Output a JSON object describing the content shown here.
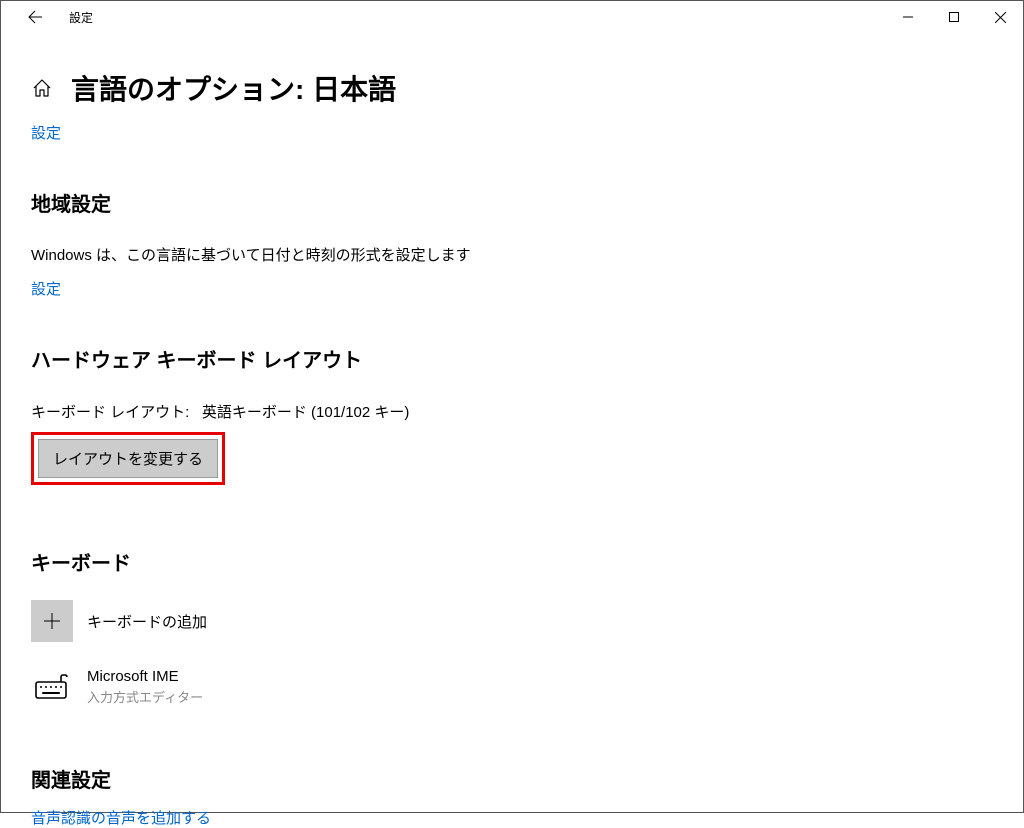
{
  "window_title": "設定",
  "page_title": "言語のオプション: 日本語",
  "settings_link": "設定",
  "region": {
    "title": "地域設定",
    "description": "Windows は、この言語に基づいて日付と時刻の形式を設定します",
    "link": "設定"
  },
  "hardware": {
    "title": "ハードウェア キーボード レイアウト",
    "layout_label": "キーボード レイアウト:",
    "layout_value": "英語キーボード (101/102 キー)",
    "change_button": "レイアウトを変更する"
  },
  "keyboard": {
    "title": "キーボード",
    "add_label": "キーボードの追加",
    "ime_name": "Microsoft IME",
    "ime_sub": "入力方式エディター"
  },
  "related": {
    "title": "関連設定",
    "speech_link": "音声認識の音声を追加する"
  }
}
